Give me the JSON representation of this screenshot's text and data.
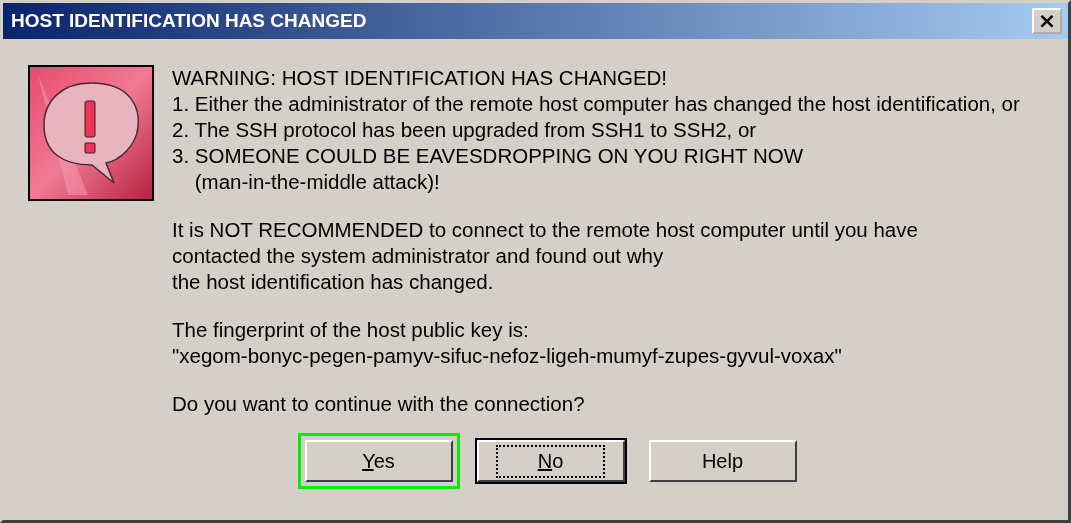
{
  "window": {
    "title": "HOST IDENTIFICATION HAS CHANGED",
    "close_symbol": "×"
  },
  "paragraphs": [
    [
      "WARNING: HOST IDENTIFICATION HAS CHANGED!",
      "1. Either the administrator of the remote host computer has changed the host identification, or",
      "2. The SSH protocol has been upgraded from SSH1 to SSH2, or",
      "3. SOMEONE COULD BE EAVESDROPPING ON YOU RIGHT NOW",
      "    (man-in-the-middle attack)!"
    ],
    [
      "It is NOT RECOMMENDED to connect to the remote host computer until you have",
      "contacted the system administrator and found out why",
      "the host identification has changed."
    ],
    [
      "The fingerprint of the host public key is:",
      "\"xegom-bonyc-pegen-pamyv-sifuc-nefoz-ligeh-mumyf-zupes-gyvul-voxax\""
    ],
    [
      "Do you want to continue with the connection?"
    ]
  ],
  "buttons": [
    {
      "label": "Yes",
      "underline_first": true,
      "focused": false,
      "highlighted": true
    },
    {
      "label": "No",
      "underline_first": true,
      "focused": true,
      "highlighted": false
    },
    {
      "label": "Help",
      "underline_first": false,
      "focused": false,
      "highlighted": false
    }
  ]
}
